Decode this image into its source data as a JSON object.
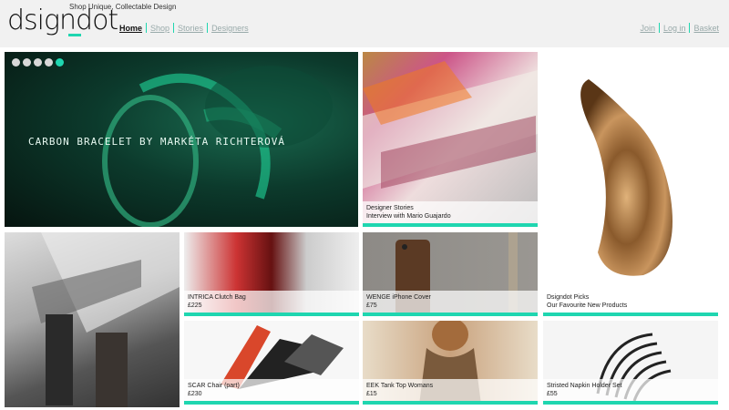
{
  "brand": {
    "logo": "dsigndot",
    "tagline": "Shop Unique, Collectable Design",
    "accent": "#1fd6b0"
  },
  "nav": {
    "home": "Home",
    "shop": "Shop",
    "stories": "Stories",
    "designers": "Designers"
  },
  "account": {
    "join": "Join",
    "login": "Log in",
    "basket": "Basket"
  },
  "hero": {
    "title": "CARBON BRACELET BY MARKÉTA RICHTEROVÁ",
    "slide_count": 5,
    "active_slide": 5
  },
  "tiles": {
    "stories": {
      "line1": "Designer Stories",
      "line2": "Interview with Mario Guajardo"
    },
    "picks": {
      "line1": "Dsigndot Picks",
      "line2": "Our Favourite New Products"
    },
    "intrica": {
      "name": "INTRICA Clutch Bag",
      "price": "£225"
    },
    "wenge": {
      "name": "WENGE iPhone Cover",
      "price": "£75"
    },
    "scar": {
      "name": "SCAR Chair (part)",
      "price": "£230"
    },
    "eek": {
      "name": "EEK Tank Top Womans",
      "price": "£15"
    },
    "napkin": {
      "name": "Stristed Napkin Holder Set",
      "price": "£55"
    }
  }
}
